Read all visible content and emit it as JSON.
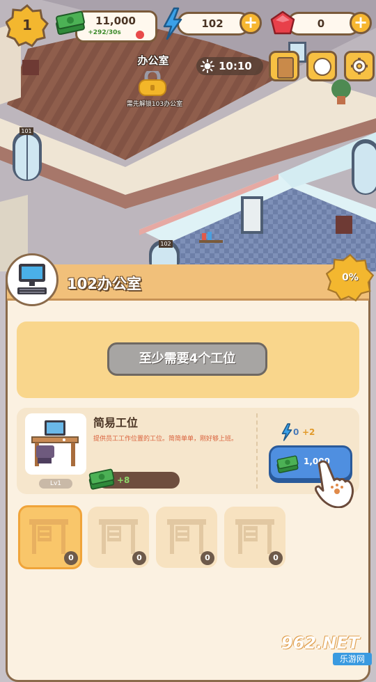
{
  "hud": {
    "level": "1",
    "cash_amount": "11,000",
    "cash_rate": "+292/30s",
    "energy_amount": "102",
    "gems_amount": "0",
    "clock_time": "10:10"
  },
  "room_lock": {
    "name": "办公室",
    "hint": "需先解锁103办公室"
  },
  "door_plates": [
    "101",
    "102"
  ],
  "panel": {
    "title": "102办公室",
    "progress": "0%",
    "requirement_button": "至少需要4个工位",
    "item": {
      "name": "简易工位",
      "description": "提供员工工作位置的工位。简简单单，刚好够上班。",
      "level": "Lv1",
      "income": "+8",
      "energy_cost": "0",
      "energy_gain": "+2",
      "buy_price": "1,000"
    },
    "slots": [
      {
        "count": "0",
        "selected": true
      },
      {
        "count": "0",
        "selected": false
      },
      {
        "count": "0",
        "selected": false
      },
      {
        "count": "0",
        "selected": false
      }
    ]
  },
  "watermark": {
    "brand": "962.NET",
    "sub": "乐游网"
  },
  "colors": {
    "accent_orange": "#f7b731",
    "outline_brown": "#7a5a3a",
    "panel_cream": "#fbf1e1",
    "buy_blue": "#4f8fe0",
    "energy_blue": "#3aa0e8",
    "gem_red": "#e8404a"
  },
  "icons": [
    "level-badge-icon",
    "cash-icon",
    "lightning-icon",
    "gem-icon",
    "plus-icon",
    "sun-icon",
    "book-icon",
    "face-icon",
    "gear-icon",
    "lock-icon",
    "computer-icon",
    "desk-icon",
    "hand-pointer-icon"
  ]
}
